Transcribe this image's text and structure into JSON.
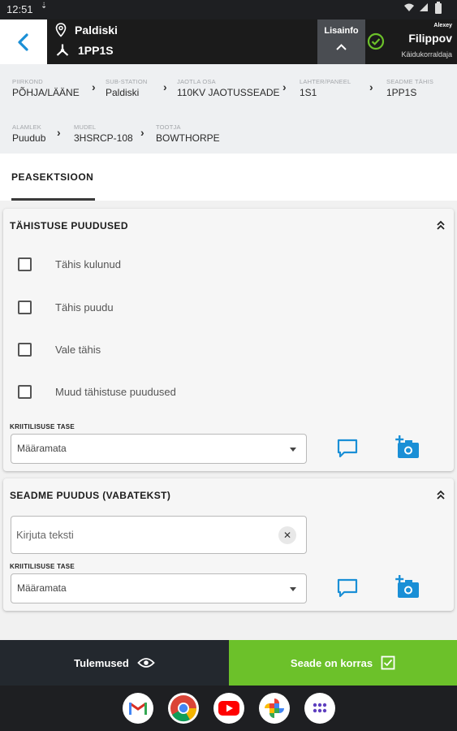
{
  "status_bar": {
    "time": "12:51"
  },
  "header": {
    "location": "Paldiski",
    "device": "1PP1S",
    "lisainfo_label": "Lisainfo",
    "user": {
      "first_name": "Alexey",
      "last_name": "Filippov",
      "role": "Käidukorraldaja"
    }
  },
  "breadcrumbs": [
    {
      "key": "PIIRKOND",
      "value": "PÕHJA/LÄÄNE"
    },
    {
      "key": "SUB-STATION",
      "value": "Paldiski"
    },
    {
      "key": "JAOTLA OSA",
      "value": "110KV JAOTUSSEADE"
    },
    {
      "key": "LAHTER/PANEEL",
      "value": "1S1"
    },
    {
      "key": "SEADME TÄHIS",
      "value": "1PP1S"
    },
    {
      "key": "ALAMLEK",
      "value": "Puudub"
    },
    {
      "key": "MUDEL",
      "value": "3HSRCP-108"
    },
    {
      "key": "TOOTJA",
      "value": "BOWTHORPE"
    }
  ],
  "tabs": {
    "active": "PEASEKTSIOON"
  },
  "section_markings": {
    "title": "TÄHISTUSE PUUDUSED",
    "checkboxes": [
      {
        "label": "Tähis kulunud",
        "checked": false
      },
      {
        "label": "Tähis puudu",
        "checked": false
      },
      {
        "label": "Vale tähis",
        "checked": false
      },
      {
        "label": "Muud tähistuse puudused",
        "checked": false
      }
    ],
    "criticality_label": "KRIITILISUSE TASE",
    "criticality_value": "Määramata"
  },
  "section_freetext": {
    "title": "SEADME PUUDUS (VABATEKST)",
    "input_placeholder": "Kirjuta teksti",
    "criticality_label": "KRIITILISUSE TASE",
    "criticality_value": "Määramata"
  },
  "bottom_actions": {
    "results_label": "Tulemused",
    "ok_label": "Seade on korras"
  },
  "colors": {
    "accent_blue": "#1a8fd6",
    "ok_green": "#6cc12a",
    "header_dark": "#1b1b1b"
  },
  "dock_apps": [
    "gmail-icon",
    "chrome-icon",
    "youtube-icon",
    "photos-icon",
    "apps-icon"
  ]
}
